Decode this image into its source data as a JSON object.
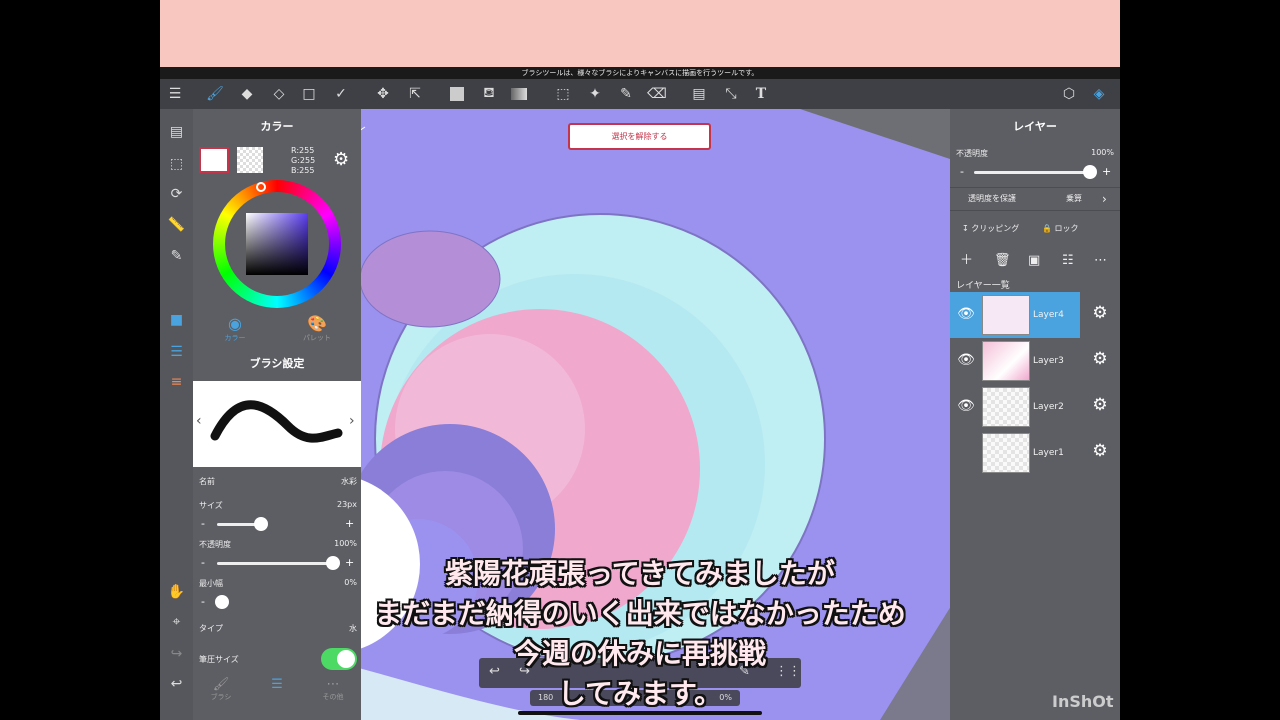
{
  "top_hint": "ブラシツールは、様々なブラシによりキャンバスに描画を行うツールです。",
  "toolbar_icons": [
    "menu-icon",
    "brush-icon",
    "eraser-icon",
    "smudge-icon",
    "rectangle-icon",
    "curve-icon",
    "move-icon",
    "transform-icon",
    "fill-color-icon",
    "bucket-icon",
    "gradient-icon",
    "select-rect-icon",
    "magic-wand-icon",
    "select-pen-icon",
    "select-eraser-icon",
    "layout-icon",
    "dropper-icon",
    "text-icon",
    "material-icon",
    "layers-icon"
  ],
  "popup": {
    "deselect_label": "選択を解除する"
  },
  "color_panel": {
    "title": "カラー",
    "rgb": {
      "r": "R:255",
      "g": "G:255",
      "b": "B:255"
    },
    "tabs": [
      {
        "label": "カラー"
      },
      {
        "label": "パレット"
      }
    ]
  },
  "brush_panel": {
    "title": "ブラシ設定",
    "name_label": "名前",
    "name_value": "水彩",
    "size_label": "サイズ",
    "size_value": "23px",
    "size_level": 0.5,
    "opacity_label": "不透明度",
    "opacity_value": "100%",
    "opacity_level": 1.0,
    "min_width_label": "最小幅",
    "min_width_value": "0%",
    "min_width_level": 0.0,
    "type_label": "タイプ",
    "type_value": "水",
    "pressure_size_label": "筆圧サイズ",
    "pressure_size_on": true,
    "tabs": [
      {
        "label": "ブラシ"
      },
      {
        "label": ""
      },
      {
        "label": "その他"
      }
    ]
  },
  "layer_panel": {
    "title": "レイヤー",
    "opacity_label": "不透明度",
    "opacity_value": "100%",
    "minus": "-",
    "plus": "+",
    "protect_alpha_label": "透明度を保護",
    "blend_mode": "乗算",
    "clipping_label": "クリッピング",
    "lock_label": "ロック",
    "list_title": "レイヤー一覧",
    "layers": [
      {
        "name": "Layer4",
        "selected": true
      },
      {
        "name": "Layer3",
        "selected": false
      },
      {
        "name": "Layer2",
        "selected": false
      },
      {
        "name": "Layer1",
        "selected": false
      }
    ]
  },
  "bottom_status": {
    "left": "180",
    "right": "0%"
  },
  "subtitles": [
    "紫陽花頑張ってきてみましたが",
    "まだまだ納得のいく出来ではなかったため",
    "今週の休みに再挑戦",
    "してみます。"
  ],
  "watermark": "InShOt",
  "colors": {
    "accent": "#4aa3df",
    "canvas_bg": "#9b92f0",
    "toggle_on": "#4cd964"
  }
}
